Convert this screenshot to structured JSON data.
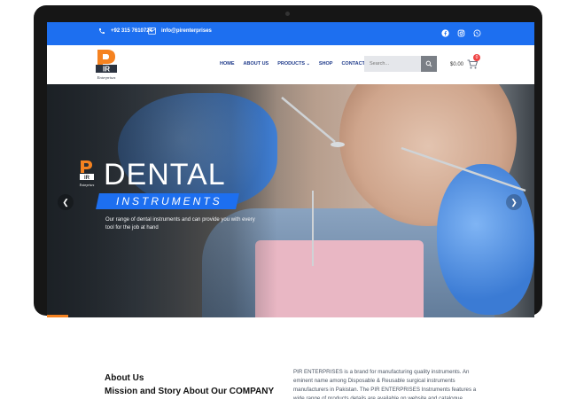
{
  "topbar": {
    "phone": "+92 315 7610724",
    "email": "info@pirenterprises",
    "social": [
      "facebook-icon",
      "instagram-icon",
      "whatsapp-icon"
    ]
  },
  "brand": {
    "name": "PIR",
    "tagline": "Enterprises"
  },
  "nav": {
    "items": [
      "HOME",
      "ABOUT US",
      "PRODUCTS",
      "SHOP",
      "CONTACT US"
    ]
  },
  "search": {
    "placeholder": "Search..."
  },
  "cart": {
    "total": "$0.00",
    "count": "0"
  },
  "hero": {
    "title": "DENTAL",
    "subtitle": "INSTRUMENTS",
    "description": "Our range of dental instruments and can provide you with every tool for the job at hand"
  },
  "about": {
    "title": "About Us",
    "subtitle": "Mission and Story About Our COMPANY",
    "text": "PIR ENTERPRISES is a brand for manufacturing quality instruments. An eminent name among Disposable & Reusable surgical instruments manufacturers in Pakistan. The PIR ENTERPRISES Instruments features a wide range of products details are available on website and catalogue"
  },
  "colors": {
    "brand_blue": "#1d6ff0",
    "accent_orange": "#f58220",
    "nav_text": "#1e3a8a"
  }
}
